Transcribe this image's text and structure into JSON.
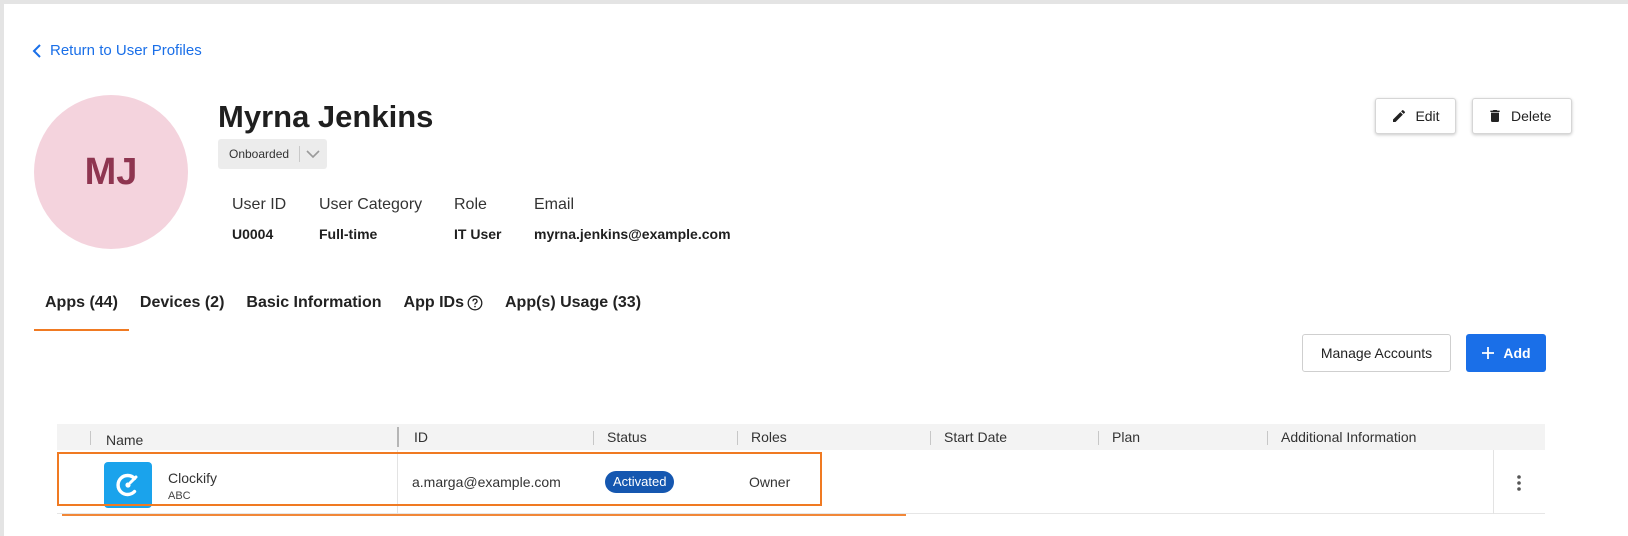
{
  "nav": {
    "back_label": "Return to User Profiles"
  },
  "profile": {
    "initials": "MJ",
    "name": "Myrna Jenkins",
    "status_value": "Onboarded",
    "avatar_color": "#f4d3dd",
    "initials_color": "#8e3550"
  },
  "actions": {
    "edit_label": "Edit",
    "delete_label": "Delete"
  },
  "fields": [
    {
      "label": "User ID",
      "value": "U0004"
    },
    {
      "label": "User Category",
      "value": "Full-time"
    },
    {
      "label": "Role",
      "value": "IT User"
    },
    {
      "label": "Email",
      "value": "myrna.jenkins@example.com"
    }
  ],
  "tabs": [
    {
      "label": "Apps (44)",
      "active": true
    },
    {
      "label": "Devices (2)"
    },
    {
      "label": "Basic Information"
    },
    {
      "label": "App IDs"
    },
    {
      "label": "App(s) Usage (33)"
    }
  ],
  "toolbar": {
    "manage_label": "Manage Accounts",
    "add_label": "Add"
  },
  "table": {
    "columns": [
      "Name",
      "ID",
      "Status",
      "Roles",
      "Start Date",
      "Plan",
      "Additional Information"
    ],
    "rows": [
      {
        "app_name": "Clockify",
        "app_sub": "ABC",
        "id": "a.marga@example.com",
        "status": "Activated",
        "roles": "Owner",
        "start_date": "",
        "plan": "",
        "additional_info": ""
      }
    ]
  },
  "colors": {
    "accent": "#1a6fe8",
    "tab_indicator": "#f07a22",
    "badge": "#1557b0",
    "app_icon": "#1aa3ec"
  }
}
